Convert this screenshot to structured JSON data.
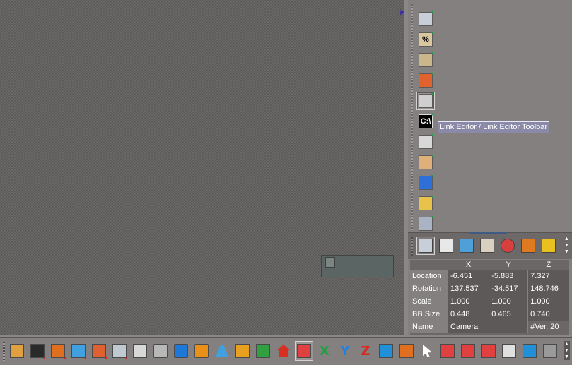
{
  "viewport": {
    "label": "3d-viewport"
  },
  "sidebar_tools": [
    {
      "icon": "grid-plane-icon",
      "color": "#c9cfd8",
      "glyph": ""
    },
    {
      "icon": "percent-icon",
      "color": "#d9c7a0",
      "glyph": "%"
    },
    {
      "icon": "pencil-ruler-icon",
      "color": "#c9b68a",
      "glyph": ""
    },
    {
      "icon": "magnet-icon",
      "color": "#e0622c",
      "glyph": ""
    },
    {
      "icon": "list-view-icon",
      "color": "#cfcfcf",
      "glyph": ""
    },
    {
      "icon": "command-prompt-icon",
      "color": "#000000",
      "glyph": "C:\\"
    },
    {
      "icon": "layers-icon",
      "color": "#d8d8d8",
      "glyph": ""
    },
    {
      "icon": "panel-icon",
      "color": "#e0b07a",
      "glyph": ""
    },
    {
      "icon": "record-play-icon",
      "color": "#2e6fd8",
      "glyph": ""
    },
    {
      "icon": "hand-tool-icon",
      "color": "#e8c24a",
      "glyph": ""
    },
    {
      "icon": "schematic-icon",
      "color": "#a9b3c4",
      "glyph": ""
    }
  ],
  "tooltip": {
    "text": "Link Editor / Link Editor Toolbar"
  },
  "tabs": [
    {
      "icon": "grid-tab-icon",
      "color": "#c9cfd8"
    },
    {
      "icon": "camera-tab-icon",
      "color": "#e8e8e8"
    },
    {
      "icon": "render-tab-icon",
      "color": "#4fa0d8"
    },
    {
      "icon": "light-tab-icon",
      "color": "#d9d0c0"
    },
    {
      "icon": "material-tab-icon",
      "color": "#d84040"
    },
    {
      "icon": "object-tab-icon",
      "color": "#e07a20"
    },
    {
      "icon": "folder-tab-icon",
      "color": "#e8c020"
    }
  ],
  "props": {
    "headers": [
      "X",
      "Y",
      "Z"
    ],
    "rows": [
      {
        "label": "Location",
        "x": "-6.451",
        "y": "-5.883",
        "z": "7.327"
      },
      {
        "label": "Rotation",
        "x": "137.537",
        "y": "-34.517",
        "z": "148.746"
      },
      {
        "label": "Scale",
        "x": "1.000",
        "y": "1.000",
        "z": "1.000"
      },
      {
        "label": "BB Size",
        "x": "0.448",
        "y": "0.465",
        "z": "0.740"
      }
    ],
    "name_label": "Name",
    "name_value": "Camera",
    "version": "#Ver. 20"
  },
  "bottom_tools": [
    {
      "icon": "select-axis-icon",
      "color": "#e0a040",
      "glyph": ""
    },
    {
      "icon": "hide-icon",
      "color": "#2a2a2a",
      "glyph": ""
    },
    {
      "icon": "pencil-move-icon",
      "color": "#e07020",
      "glyph": ""
    },
    {
      "icon": "pencil-scale-icon",
      "color": "#40a0e0",
      "glyph": ""
    },
    {
      "icon": "box-stack-icon",
      "color": "#e06030",
      "glyph": ""
    },
    {
      "icon": "mesh-grid-icon",
      "color": "#c0c8d0",
      "glyph": ""
    },
    {
      "icon": "palette-icon",
      "color": "#d8d8d8",
      "glyph": ""
    },
    {
      "icon": "cube-gray-icon",
      "color": "#b8b8b8",
      "glyph": ""
    },
    {
      "icon": "cube-blue-icon",
      "color": "#1e78d8",
      "glyph": ""
    },
    {
      "icon": "cube-orange-icon",
      "color": "#e89018",
      "glyph": ""
    },
    {
      "icon": "spotlight-icon",
      "color": "#40a0e0",
      "glyph": ""
    },
    {
      "icon": "lamp-icon",
      "color": "#e8a020",
      "glyph": ""
    },
    {
      "icon": "axis-rotate-icon",
      "color": "#30a040",
      "glyph": ""
    },
    {
      "icon": "house-icon",
      "color": "#d83020",
      "glyph": ""
    },
    {
      "icon": "axes-icon",
      "color": "#e04040",
      "glyph": ""
    },
    {
      "icon": "x-axis-icon",
      "color": "#20a040",
      "glyph": "X"
    },
    {
      "icon": "y-axis-icon",
      "color": "#2080e0",
      "glyph": "Y"
    },
    {
      "icon": "z-axis-icon",
      "color": "#d82820",
      "glyph": "Z"
    },
    {
      "icon": "rotate-arrow-icon",
      "color": "#2090d8",
      "glyph": ""
    },
    {
      "icon": "transform-icon",
      "color": "#e07020",
      "glyph": ""
    },
    {
      "icon": "pointer-icon",
      "color": "#ffffff",
      "glyph": ""
    },
    {
      "icon": "axis-move-icon",
      "color": "#e04040",
      "glyph": ""
    },
    {
      "icon": "axis-scale-icon",
      "color": "#e04040",
      "glyph": ""
    },
    {
      "icon": "axis-rotate2-icon",
      "color": "#e04040",
      "glyph": ""
    },
    {
      "icon": "wire-cube-icon",
      "color": "#e0e0e0",
      "glyph": ""
    },
    {
      "icon": "axis-local-icon",
      "color": "#2090d8",
      "glyph": ""
    },
    {
      "icon": "gizmo-icon",
      "color": "#9a9a9a",
      "glyph": ""
    }
  ]
}
